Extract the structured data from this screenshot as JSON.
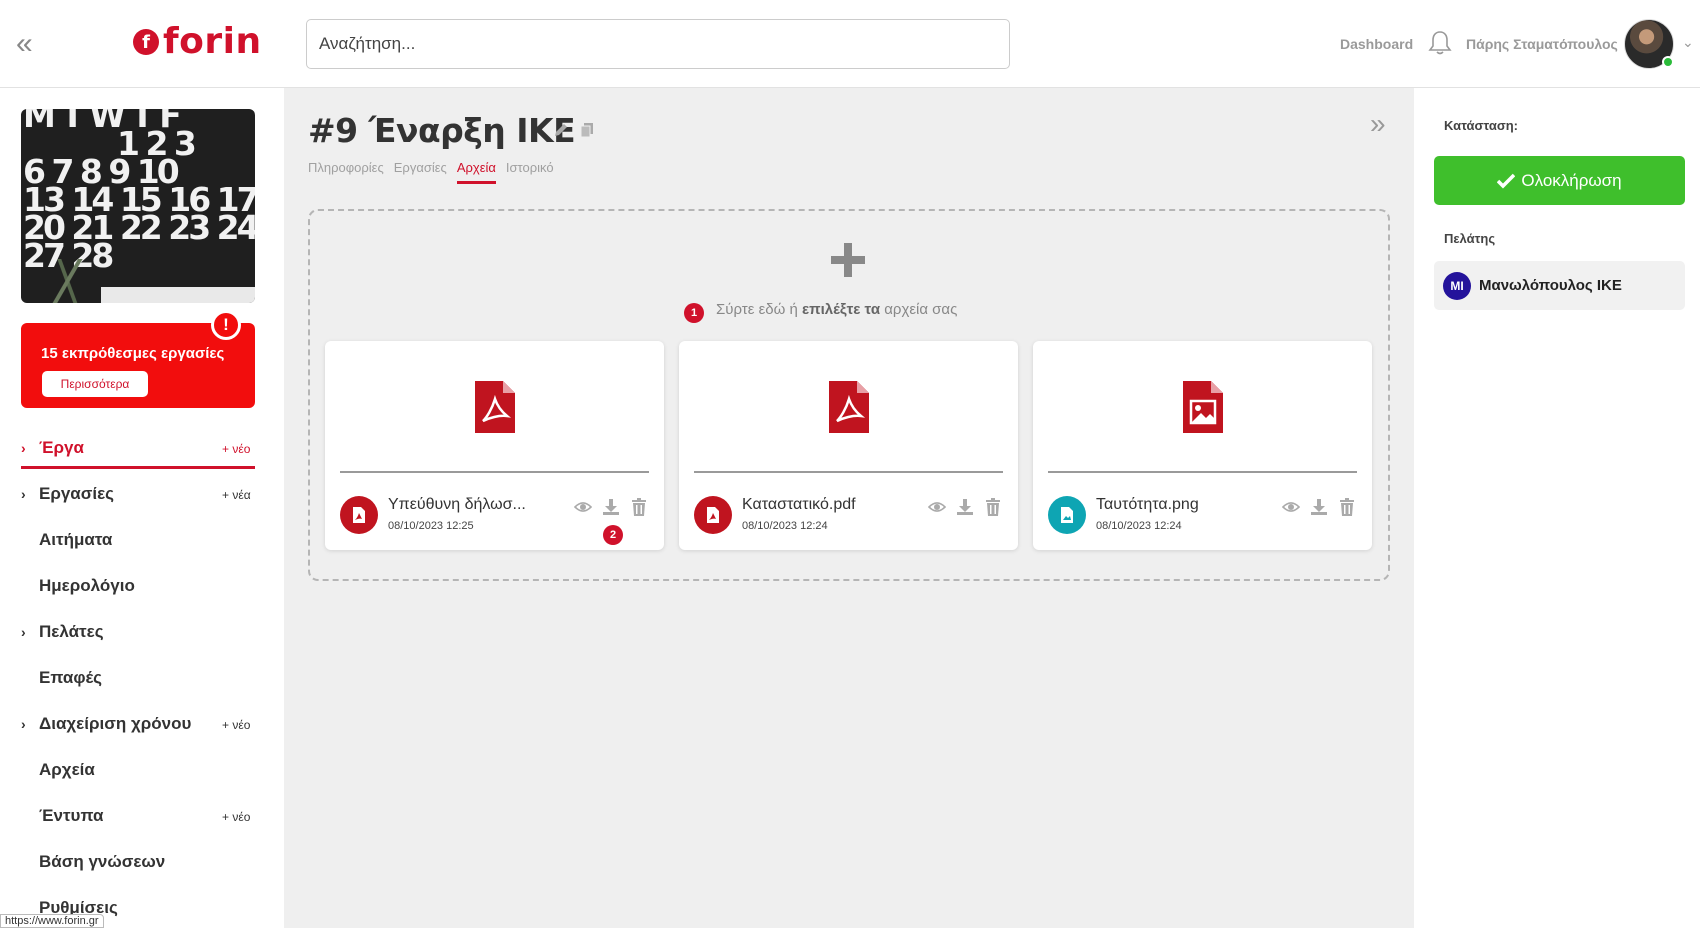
{
  "header": {
    "logo_text": "forin",
    "logo_mark": "f",
    "search_placeholder": "Αναζήτηση...",
    "dashboard_label": "Dashboard",
    "user_name": "Πάρης Σταματόπουλος"
  },
  "sidebar": {
    "calendar_rows": [
      "M T W T F",
      "1 2 3",
      "6 7 8 9 10",
      "13 14 15 16 17",
      "20 21 22 23 24",
      "27 28"
    ],
    "overdue_title": "15 εκπρόθεσμες εργασίες",
    "overdue_button": "Περισσότερα",
    "overdue_badge": "!",
    "nav": [
      {
        "label": "Έργα",
        "new": "+ νέο",
        "caret": "›"
      },
      {
        "label": "Εργασίες",
        "new": "+ νέα",
        "caret": "›"
      },
      {
        "label": "Αιτήματα"
      },
      {
        "label": "Ημερολόγιο"
      },
      {
        "label": "Πελάτες",
        "caret": "›"
      },
      {
        "label": "Επαφές"
      },
      {
        "label": "Διαχείριση χρόνου",
        "new": "+ νέο",
        "caret": "›"
      },
      {
        "label": "Αρχεία"
      },
      {
        "label": "Έντυπα",
        "new": "+ νέο"
      },
      {
        "label": "Βάση γνώσεων"
      },
      {
        "label": "Ρυθμίσεις"
      }
    ],
    "status_url": "https://www.forin.gr"
  },
  "main": {
    "title": "#9 Έναρξη ΙΚΕ",
    "tabs": [
      "Πληροφορίες",
      "Εργασίες",
      "Αρχεία",
      "Ιστορικό"
    ],
    "active_tab": "Αρχεία",
    "dropzone": {
      "step": "1",
      "text_before": "Σύρτε εδώ ή",
      "text_bold": "επιλέξτε τα",
      "text_after": "αρχεία σας"
    },
    "files": [
      {
        "name": "Υπεύθυνη δήλωσ...",
        "date": "08/10/2023 12:25",
        "type": "pdf-icon",
        "color": "#c0141f"
      },
      {
        "name": "Καταστατικό.pdf",
        "date": "08/10/2023 12:24",
        "type": "pdf-icon",
        "color": "#c0141f"
      },
      {
        "name": "Ταυτότητα.png",
        "date": "08/10/2023 12:24",
        "type": "image-icon",
        "color": "#0ea5b3"
      }
    ],
    "step2": "2"
  },
  "right_panel": {
    "status_label": "Κατάσταση:",
    "complete_button": "Ολοκλήρωση",
    "client_label": "Πελάτης",
    "client_initials": "ΜΙ",
    "client_name": "Μανωλόπουλος ΙΚΕ"
  },
  "colors": {
    "brand": "#d0112b",
    "success": "#3fbf2c",
    "client_avatar": "#24139b"
  }
}
